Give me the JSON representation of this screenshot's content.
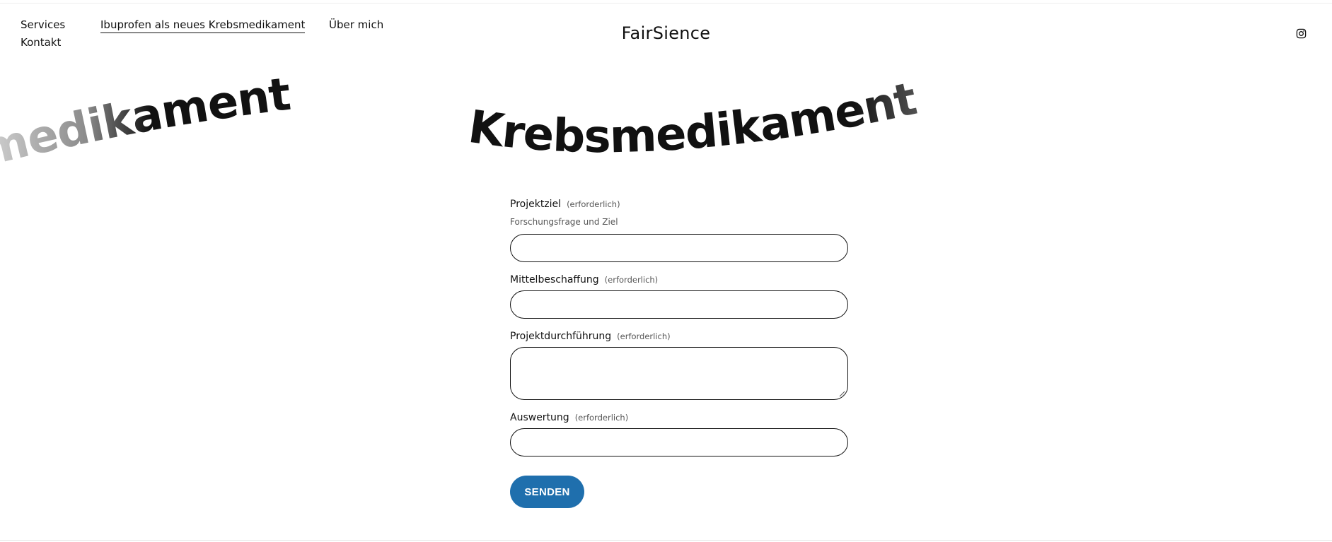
{
  "nav": {
    "services": "Services",
    "ibuprofen": "Ibuprofen als neues Krebsmedikament",
    "ueber": "Über mich",
    "kontakt": "Kontakt"
  },
  "brand": "FairSience",
  "social": {
    "icon": "instagram-icon"
  },
  "banner": {
    "left_fragment": "medikament",
    "center_word": "Krebsmedikament"
  },
  "form": {
    "fields": [
      {
        "label": "Projektziel",
        "required": "(erforderlich)",
        "description": "Forschungsfrage und Ziel",
        "value": ""
      },
      {
        "label": "Mittelbeschaffung",
        "required": "(erforderlich)",
        "value": ""
      },
      {
        "label": "Projektdurchführung",
        "required": "(erforderlich)",
        "value": ""
      },
      {
        "label": "Auswertung",
        "required": "(erforderlich)",
        "value": ""
      }
    ],
    "submit_label": "SENDEN"
  },
  "colors": {
    "accent": "#1f6fad",
    "text": "#111111",
    "border": "#111111"
  }
}
